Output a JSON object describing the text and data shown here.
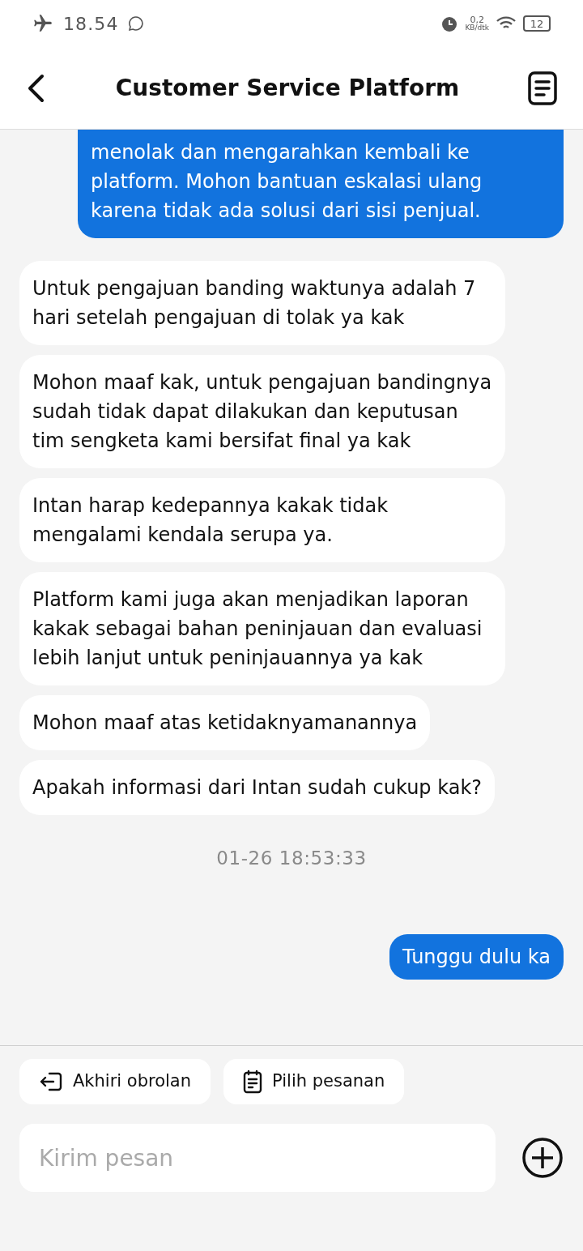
{
  "status_bar": {
    "time": "18.54",
    "network_speed": "0,2",
    "network_unit": "KB/dtk",
    "battery": "12"
  },
  "header": {
    "title": "Customer Service Platform"
  },
  "messages": [
    {
      "kind": "user",
      "text": "menolak dan mengarahkan kembali ke platform. Mohon bantuan eskalasi ulang karena tidak ada solusi dari sisi penjual.",
      "cut": true
    },
    {
      "kind": "agent",
      "text": "Untuk pengajuan banding waktunya adalah 7 hari setelah pengajuan di tolak ya kak"
    },
    {
      "kind": "agent",
      "text": "Mohon maaf kak, untuk pengajuan bandingnya sudah tidak dapat dilakukan dan keputusan tim sengketa kami bersifat final ya kak"
    },
    {
      "kind": "agent",
      "text": "Intan harap kedepannya kakak tidak mengalami kendala serupa ya."
    },
    {
      "kind": "agent",
      "text": "Platform kami juga akan menjadikan laporan kakak sebagai bahan peninjauan dan evaluasi lebih lanjut untuk peninjauannya ya kak"
    },
    {
      "kind": "agent",
      "text": "Mohon maaf atas ketidaknyamanannya"
    },
    {
      "kind": "agent",
      "text": "Apakah informasi dari Intan sudah cukup kak?"
    },
    {
      "kind": "time",
      "text": "01-26 18:53:33"
    },
    {
      "kind": "user",
      "text": "Tunggu dulu ka",
      "cut": false
    }
  ],
  "quick_actions": [
    {
      "kind": "exit",
      "label": "Akhiri obrolan"
    },
    {
      "kind": "order",
      "label": "Pilih pesanan"
    }
  ],
  "composer": {
    "placeholder": "Kirim pesan"
  }
}
